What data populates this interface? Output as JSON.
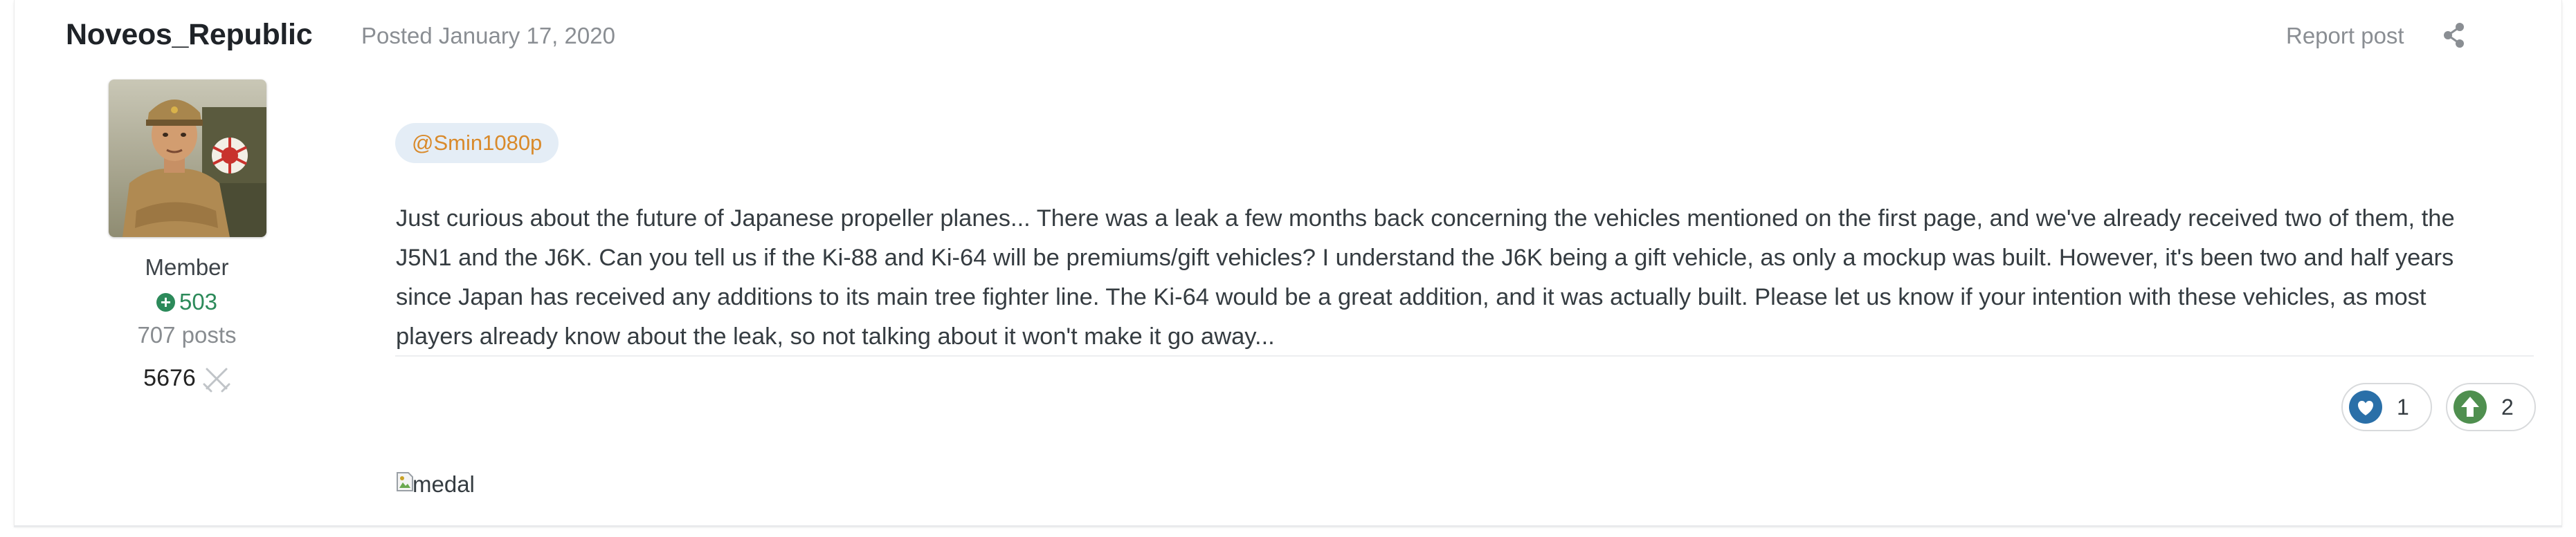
{
  "author": {
    "name": "Noveos_Republic",
    "rank": "Member",
    "reputation": "503",
    "posts": "707 posts",
    "battles": "5676"
  },
  "post": {
    "posted": "Posted January 17, 2020",
    "report_label": "Report post",
    "mention": "@Smin1080p",
    "body": "Just curious about the future of Japanese propeller planes... There was a leak a few months back concerning the vehicles mentioned on the first page, and we've already received two of them, the J5N1 and the J6K. Can you tell us if the Ki-88 and Ki-64 will be premiums/gift vehicles? I understand the J6K being a gift vehicle, as only a mockup was built. However, it's been two and half years since Japan has received any additions to its main tree fighter line. The Ki-64 would be a great addition, and it was actually built. Please let us know if your intention with these vehicles, as most players already know about the leak, so not talking about it won't make it go away...",
    "signature_alt": "medal"
  },
  "reactions": [
    {
      "name": "like",
      "icon": "heart-icon",
      "count": "1",
      "color": "#2a6fa8"
    },
    {
      "name": "upvote",
      "icon": "arrow-up-icon",
      "count": "2",
      "color": "#4f8f4f"
    }
  ],
  "colors": {
    "mention_bg": "#e4edf6",
    "mention_text": "#d98a2b",
    "reputation": "#2c8a5a",
    "muted": "#8a8e93"
  }
}
